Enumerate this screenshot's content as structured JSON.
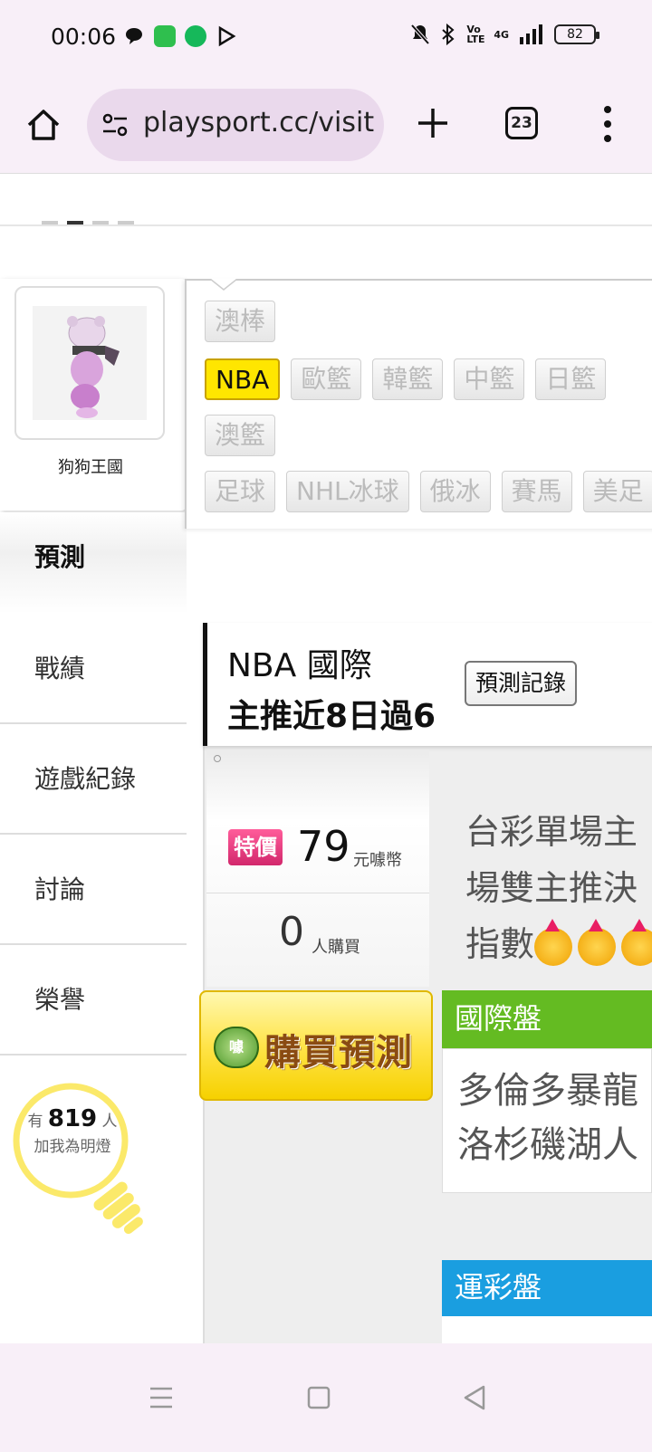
{
  "status_bar": {
    "time": "00:06",
    "network": "4G",
    "volte": "Vo LTE",
    "battery": "82"
  },
  "browser": {
    "url": "playsport.cc/visit",
    "tab_count": "23"
  },
  "profile": {
    "name": "狗狗王國"
  },
  "nav": {
    "items": [
      "預測",
      "戰績",
      "遊戲紀錄",
      "討論",
      "榮譽"
    ]
  },
  "fans": {
    "prefix": "有",
    "count": "819",
    "suffix": "人",
    "label": "加我為明燈"
  },
  "sport_tags": {
    "row1": [
      "澳棒"
    ],
    "row2": [
      "NBA",
      "歐籃",
      "韓籃",
      "中籃",
      "日籃"
    ],
    "row3": [
      "澳籃"
    ],
    "row4": [
      "足球",
      "NHL冰球",
      "俄冰",
      "賽馬",
      "美足"
    ],
    "active": "NBA"
  },
  "prediction_header": {
    "league": "NBA 國際",
    "record": "主推近8日過6",
    "record_button": "預測記錄"
  },
  "price_card": {
    "badge": "特價",
    "price": "79",
    "unit": "元噱幣",
    "buyers": "0",
    "buyers_unit": "人購買"
  },
  "buy_button": {
    "seal": "噱",
    "label": "購買預測"
  },
  "description": {
    "lines": [
      "台彩單場主",
      "場雙主推決",
      "指數"
    ]
  },
  "international": {
    "title": "國際盤",
    "teams": [
      "多倫多暴龍",
      "洛杉磯湖人"
    ]
  },
  "lottery": {
    "title": "運彩盤"
  },
  "colors": {
    "international_green": "#64bb22",
    "lottery_blue": "#1a9ee0",
    "active_tag_yellow": "#ffe600",
    "special_pink": "#e0357a"
  }
}
